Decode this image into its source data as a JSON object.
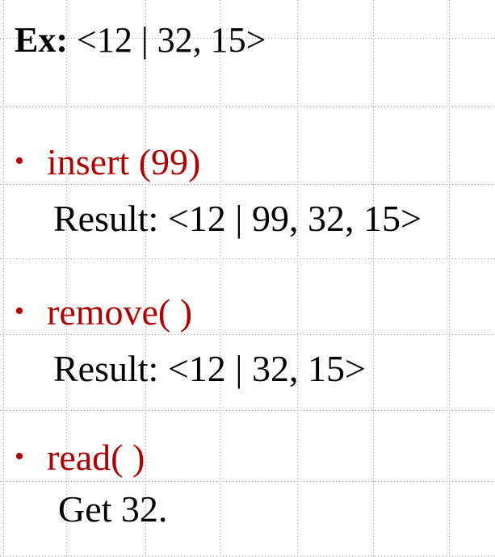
{
  "example": {
    "label": "Ex:",
    "value": "<12 | 32, 15>"
  },
  "operations": [
    {
      "call": "insert (99)",
      "result": "Result: <12 | 99, 32, 15>"
    },
    {
      "call": "remove( )",
      "result": "Result: <12 | 32, 15>"
    },
    {
      "call": "read( )",
      "result": "Get 32."
    }
  ],
  "bullet_glyph": "•",
  "colors": {
    "operation_text": "#b00000",
    "body_text": "#000000",
    "grid_dots": "#9c9c9c"
  }
}
